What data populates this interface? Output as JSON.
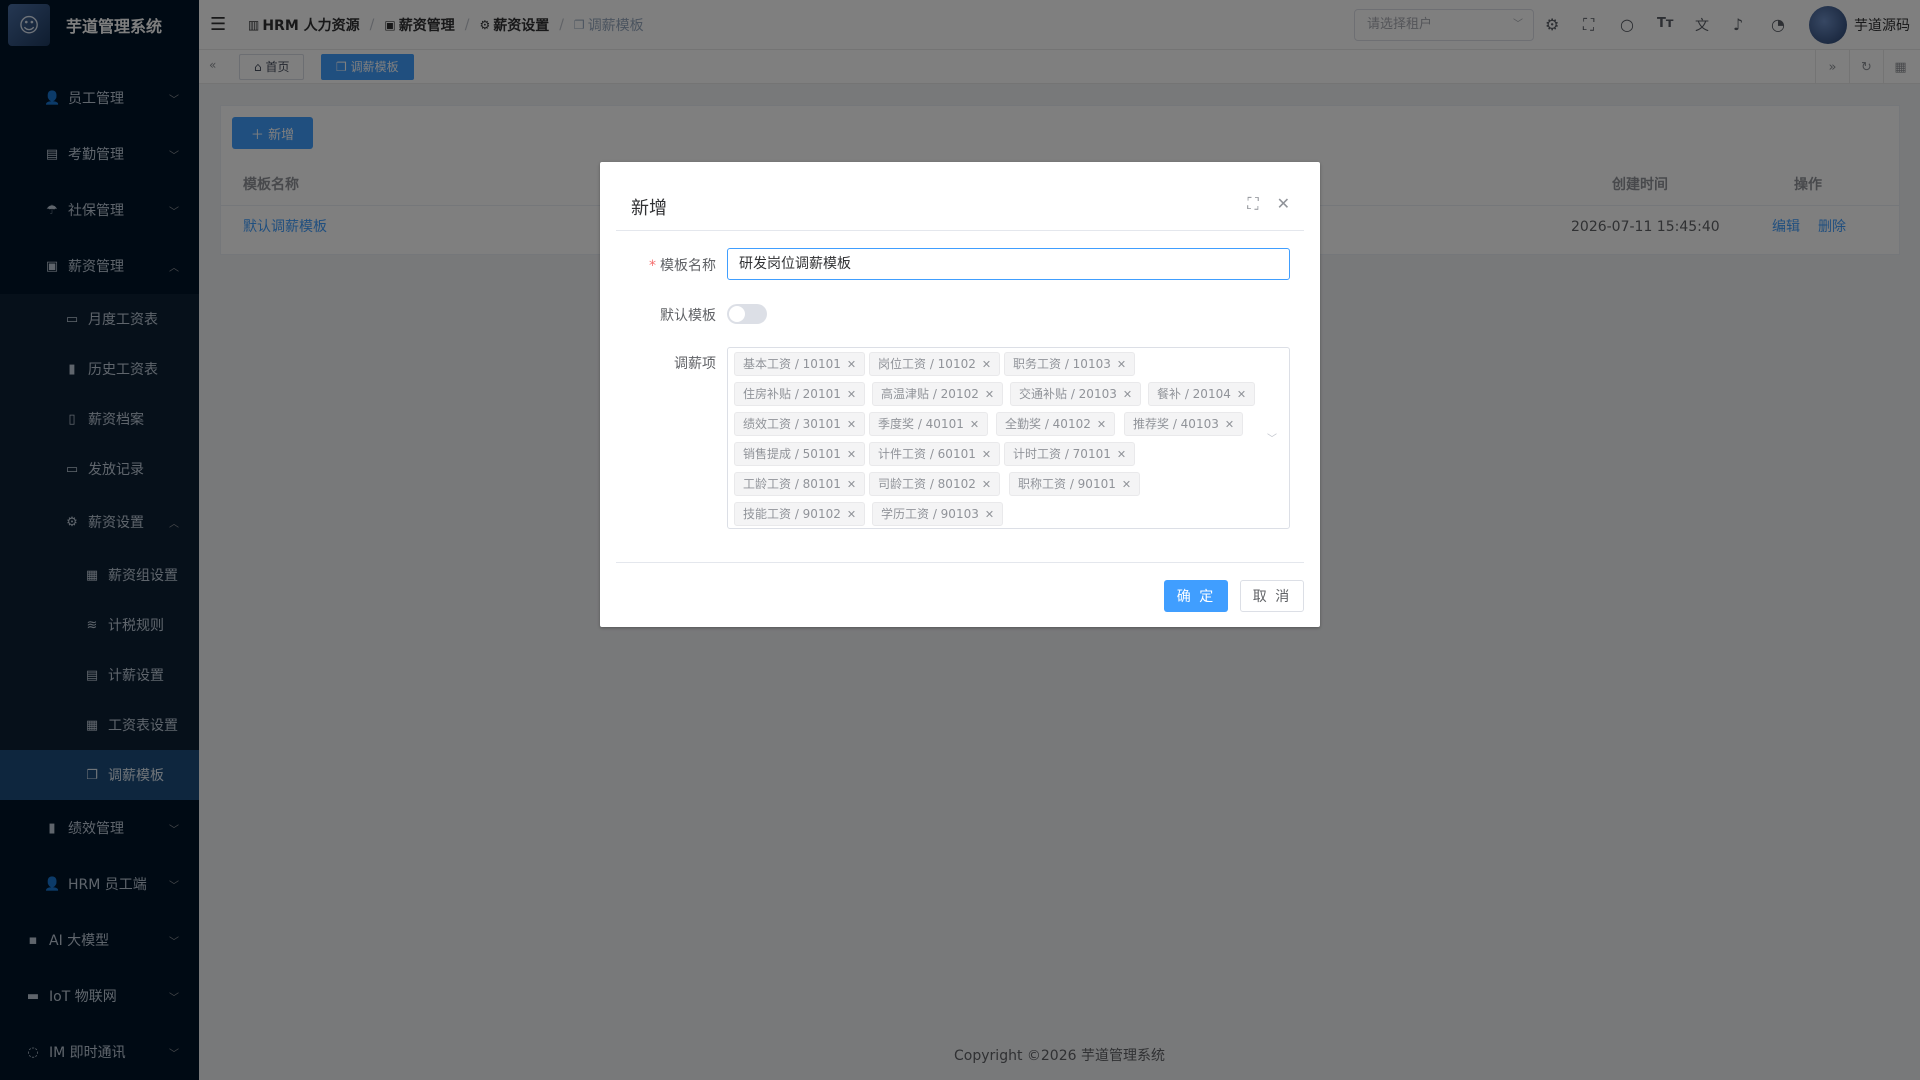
{
  "app": {
    "title": "芋道管理系统",
    "logo_icon": "robot-logo",
    "footer": "Copyright ©2026 芋道管理系统"
  },
  "sidebar": {
    "items": [
      {
        "label": "员工管理",
        "icon": "user-icon",
        "expanded": false
      },
      {
        "label": "考勤管理",
        "icon": "calendar-icon",
        "expanded": false
      },
      {
        "label": "社保管理",
        "icon": "umbrella-icon",
        "expanded": false
      },
      {
        "label": "薪资管理",
        "icon": "wallet-icon",
        "expanded": true
      },
      {
        "label": "月度工资表",
        "icon": "document-icon"
      },
      {
        "label": "历史工资表",
        "icon": "bar-chart-icon"
      },
      {
        "label": "薪资档案",
        "icon": "archive-icon"
      },
      {
        "label": "发放记录",
        "icon": "record-icon"
      },
      {
        "label": "薪资设置",
        "icon": "gear-icon",
        "expanded": true
      },
      {
        "label": "薪资组设置",
        "icon": "group-icon"
      },
      {
        "label": "计税规则",
        "icon": "database-icon"
      },
      {
        "label": "计薪设置",
        "icon": "calendar-icon"
      },
      {
        "label": "工资表设置",
        "icon": "grid-icon"
      },
      {
        "label": "调薪模板",
        "icon": "copy-icon",
        "active": true
      },
      {
        "label": "绩效管理",
        "icon": "bar-chart-icon",
        "expanded": false
      },
      {
        "label": "HRM 员工端",
        "icon": "user-icon",
        "expanded": false
      },
      {
        "label": "AI 大模型",
        "icon": "dot-icon",
        "expanded": false
      },
      {
        "label": "IoT 物联网",
        "icon": "car-icon",
        "expanded": false
      },
      {
        "label": "IM 即时通讯",
        "icon": "chat-icon",
        "expanded": false
      }
    ]
  },
  "header": {
    "breadcrumb": [
      "HRM 人力资源",
      "薪资管理",
      "薪资设置",
      "调薪模板"
    ],
    "tenant_placeholder": "请选择租户",
    "username": "芋道源码"
  },
  "tagsview": {
    "tabs": [
      {
        "label": "首页",
        "active": false
      },
      {
        "label": "调薪模板",
        "active": true
      }
    ]
  },
  "page": {
    "add_label": "新增",
    "table": {
      "columns": [
        "模板名称",
        "创建时间",
        "操作"
      ],
      "rows": [
        {
          "name": "默认调薪模板",
          "created": "2026-07-11 15:45:40",
          "edit": "编辑",
          "delete": "删除"
        }
      ]
    }
  },
  "dialog": {
    "title": "新增",
    "name_label": "模板名称",
    "name_value": "研发岗位调薪模板",
    "default_label": "默认模板",
    "default_on": false,
    "items_label": "调薪项",
    "items": [
      "基本工资 / 10101",
      "岗位工资 / 10102",
      "职务工资 / 10103",
      "住房补贴 / 20101",
      "高温津贴 / 20102",
      "交通补贴 / 20103",
      "餐补 / 20104",
      "绩效工资 / 30101",
      "季度奖 / 40101",
      "全勤奖 / 40102",
      "推荐奖 / 40103",
      "销售提成 / 50101",
      "计件工资 / 60101",
      "计时工资 / 70101",
      "工龄工资 / 80101",
      "司龄工资 / 80102",
      "职称工资 / 90101",
      "技能工资 / 90102",
      "学历工资 / 90103"
    ],
    "ok_label": "确 定",
    "cancel_label": "取 消"
  },
  "colors": {
    "primary": "#409eff",
    "sidebar_bg": "#001529",
    "sidebar_active": "#1c4d7c"
  }
}
